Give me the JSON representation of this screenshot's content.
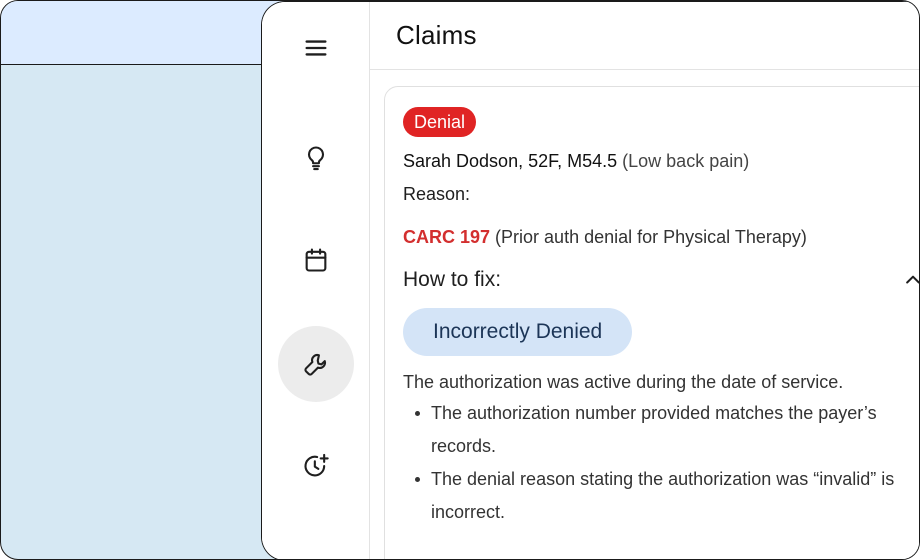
{
  "header": {
    "title": "Claims"
  },
  "rail": {
    "items": [
      {
        "icon": "menu-icon"
      },
      {
        "icon": "lightbulb-icon"
      },
      {
        "icon": "calendar-icon"
      },
      {
        "icon": "wrench-icon",
        "active": true
      },
      {
        "icon": "clock-plus-icon"
      }
    ]
  },
  "card": {
    "badge": "Denial",
    "patient": {
      "name": "Sarah Dodson, 52F, M54.5",
      "diagnosis": "(Low back pain)"
    },
    "reason_label": "Reason:",
    "carc": {
      "code": "CARC 197",
      "description": "(Prior auth denial for Physical Therapy)"
    },
    "how_to_fix": "How to fix:",
    "chip": "Incorrectly Denied",
    "explanation": "The authorization was active during the date of service.",
    "bullets": [
      "The authorization number provided matches the payer’s records.",
      "The denial reason stating the authorization was “invalid” is incorrect."
    ]
  },
  "colors": {
    "denial_badge": "#e02424",
    "carc_code": "#d32f2f",
    "chip_bg": "#d4e4f7",
    "background": "#d6e8f3"
  }
}
